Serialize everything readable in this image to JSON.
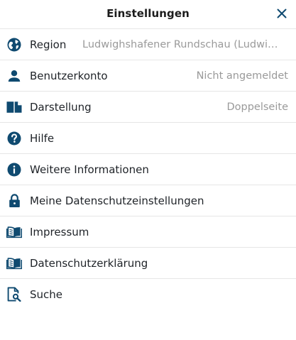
{
  "header": {
    "title": "Einstellungen",
    "close_icon": "close-icon"
  },
  "colors": {
    "icon": "#0f4a70",
    "value_text": "#9a9a9a",
    "divider": "#e6e6e6"
  },
  "items": [
    {
      "label": "Region",
      "value": "Ludwighshafener Rundschau (Ludwi…",
      "icon": "globe-icon"
    },
    {
      "label": "Benutzerkonto",
      "value": "Nicht angemeldet",
      "icon": "user-icon"
    },
    {
      "label": "Darstellung",
      "value": "Doppelseite",
      "icon": "book-icon"
    },
    {
      "label": "Hilfe",
      "value": "",
      "icon": "help-icon"
    },
    {
      "label": "Weitere Informationen",
      "value": "",
      "icon": "info-icon"
    },
    {
      "label": "Meine Datenschutzeinstellungen",
      "value": "",
      "icon": "lock-icon"
    },
    {
      "label": "Impressum",
      "value": "",
      "icon": "open-book-icon"
    },
    {
      "label": "Datenschutzerklärung",
      "value": "",
      "icon": "open-book-icon"
    },
    {
      "label": "Suche",
      "value": "",
      "icon": "document-search-icon"
    }
  ]
}
